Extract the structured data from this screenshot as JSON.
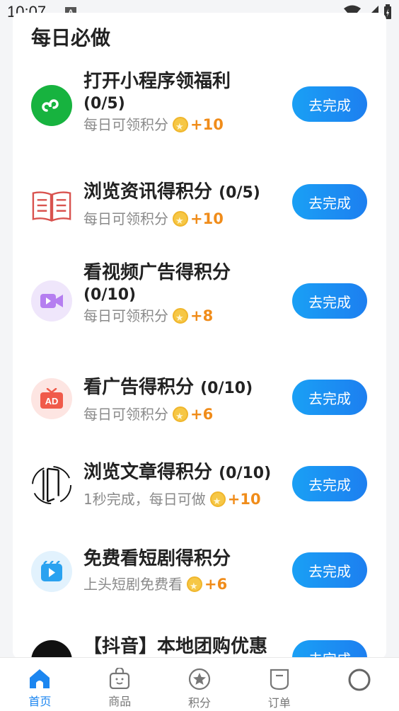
{
  "status_bar": {
    "time": "10:07",
    "notification_badge": "A"
  },
  "section": {
    "title": "每日必做"
  },
  "button_label": "去完成",
  "tasks": [
    {
      "title": "打开小程序领福利",
      "count": "(0/5)",
      "subtitle": "每日可领积分",
      "points": "+10",
      "icon": "mini-program-icon"
    },
    {
      "title": "浏览资讯得积分",
      "count": "(0/5)",
      "subtitle": "每日可领积分",
      "points": "+10",
      "icon": "book-icon"
    },
    {
      "title": "看视频广告得积分",
      "count": "(0/10)",
      "subtitle": "每日可领积分",
      "points": "+8",
      "icon": "video-camera-icon"
    },
    {
      "title": "看广告得积分",
      "count": "(0/10)",
      "subtitle": "每日可领积分",
      "points": "+6",
      "icon": "tv-ad-icon"
    },
    {
      "title": "浏览文章得积分",
      "count": "(0/10)",
      "subtitle": "1秒完成，每日可做",
      "points": "+10",
      "icon": "article-icon"
    },
    {
      "title": "免费看短剧得积分",
      "count": "",
      "subtitle": "上头短剧免费看",
      "points": "+6",
      "icon": "play-icon"
    },
    {
      "title": "【抖音】本地团购优惠",
      "count": "",
      "subtitle": "",
      "points": "",
      "icon": "douyin-icon"
    }
  ],
  "tab_bar": {
    "items": [
      {
        "label": "首页",
        "icon": "home-icon",
        "active": true
      },
      {
        "label": "商品",
        "icon": "shopping-bag-icon",
        "active": false
      },
      {
        "label": "积分",
        "icon": "points-badge-icon",
        "active": false
      },
      {
        "label": "订单",
        "icon": "order-icon",
        "active": false
      },
      {
        "label": "",
        "icon": "profile-icon",
        "active": false
      }
    ]
  },
  "colors": {
    "accent": "#1c86f0",
    "points": "#f08c1a",
    "button": "#1d8ef2"
  }
}
